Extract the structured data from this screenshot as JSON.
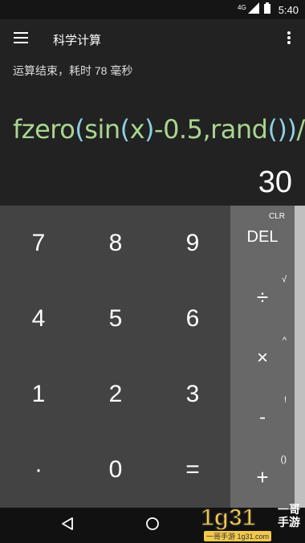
{
  "status_bar": {
    "network": "4G",
    "time": "5:40"
  },
  "app_bar": {
    "title": "科学计算"
  },
  "display": {
    "status_message": "运算结束，耗时 78 毫秒",
    "formula_parts": [
      "fzero",
      "(",
      "sin",
      "(",
      "x",
      ")",
      "-0.5,rand",
      "()",
      ")",
      "/°"
    ],
    "result": "30"
  },
  "keypad": {
    "keys": [
      "7",
      "8",
      "9",
      "4",
      "5",
      "6",
      "1",
      "2",
      "3",
      "·",
      "0",
      "="
    ]
  },
  "operators": {
    "clr": "CLR",
    "del": "DEL",
    "divide": "÷",
    "divide_alt": "√",
    "multiply": "×",
    "multiply_alt": "^",
    "minus": "-",
    "minus_alt": "!",
    "plus": "+",
    "plus_alt": "()"
  },
  "watermark": {
    "logo": "1g31",
    "brand_line1": "一哥",
    "brand_line2": "手游",
    "url": "一哥手游 1g31.com"
  },
  "colors": {
    "formula_text": "#a9d68f",
    "formula_paren": "#8dd0e3",
    "keypad_bg": "#434343",
    "ops_bg": "#686868"
  }
}
